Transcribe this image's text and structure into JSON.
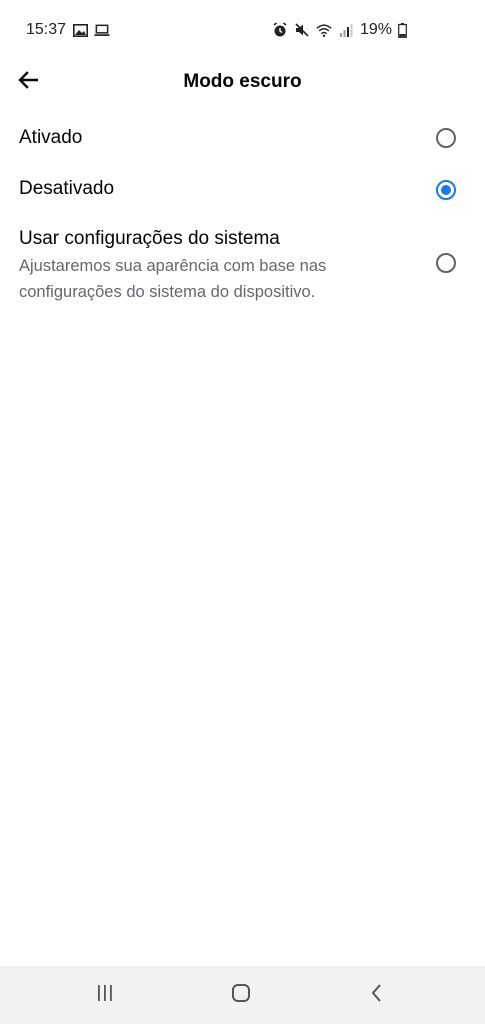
{
  "status_bar": {
    "time": "15:37",
    "battery": "19%",
    "left_icons": [
      "gallery-icon",
      "laptop-icon"
    ],
    "right_icons": [
      "alarm-icon",
      "mute-icon",
      "wifi-icon",
      "signal-icon",
      "battery-icon"
    ]
  },
  "header": {
    "title": "Modo escuro",
    "back_icon": "arrow-left-icon"
  },
  "options": [
    {
      "label": "Ativado",
      "selected": false
    },
    {
      "label": "Desativado",
      "selected": true
    },
    {
      "label": "Usar configurações do sistema",
      "description": "Ajustaremos sua aparência com base nas configurações do sistema do dispositivo.",
      "selected": false
    }
  ],
  "nav_bar": {
    "buttons": [
      "recent-apps-icon",
      "home-icon",
      "back-icon"
    ],
    "background": "#f2f2f2"
  },
  "colors": {
    "accent": "#1877f2",
    "text": "#050505",
    "secondary_text": "#65676b"
  }
}
